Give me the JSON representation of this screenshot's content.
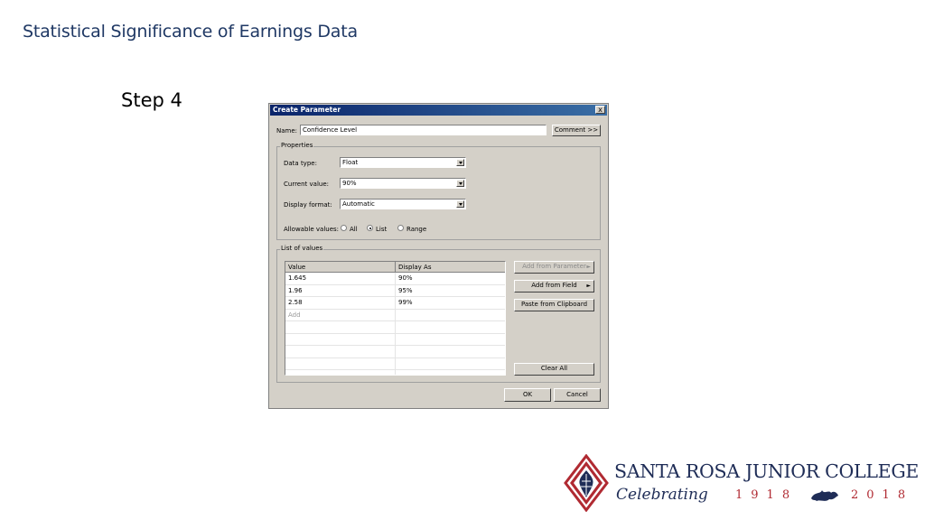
{
  "slide": {
    "title": "Statistical Significance of Earnings Data",
    "step": "Step 4"
  },
  "dialog": {
    "title": "Create Parameter",
    "close_label": "x",
    "name_label": "Name:",
    "name_value": "Confidence Level",
    "comment_button": "Comment >>",
    "properties": {
      "group_label": "Properties",
      "data_type_label": "Data type:",
      "data_type_value": "Float",
      "current_value_label": "Current value:",
      "current_value": "90%",
      "display_format_label": "Display format:",
      "display_format_value": "Automatic",
      "allowable_label": "Allowable values:",
      "allowable_options": [
        "All",
        "List",
        "Range"
      ],
      "allowable_selected": "List"
    },
    "list_of_values": {
      "group_label": "List of values",
      "columns": [
        "Value",
        "Display As"
      ],
      "rows": [
        {
          "value": "1.645",
          "display": "90%"
        },
        {
          "value": "1.96",
          "display": "95%"
        },
        {
          "value": "2.58",
          "display": "99%"
        }
      ],
      "add_placeholder": "Add",
      "add_from_parameter": "Add from Parameter",
      "add_from_field": "Add from Field",
      "paste_from_clipboard": "Paste from Clipboard",
      "clear_all": "Clear All"
    },
    "ok_button": "OK",
    "cancel_button": "Cancel"
  },
  "logo": {
    "college_name": "SANTA ROSA JUNIOR COLLEGE",
    "celebrating": "Celebrating",
    "year_start": "1918",
    "year_end": "2018"
  },
  "colors": {
    "title_blue": "#1f3864",
    "dialog_gray": "#d4d0c8",
    "titlebar_blue": "#0a246a",
    "logo_red": "#b02a32",
    "logo_navy": "#1f2d57"
  }
}
